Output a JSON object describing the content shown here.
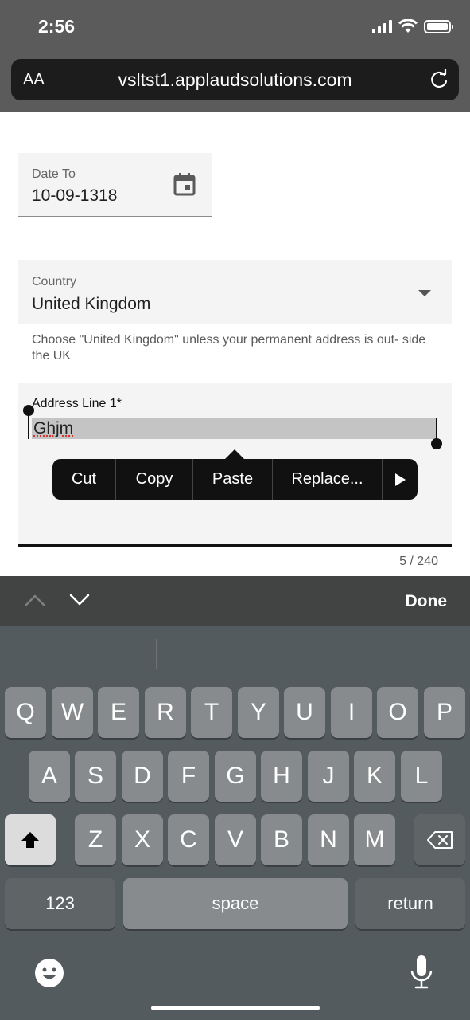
{
  "status_bar": {
    "time": "2:56"
  },
  "browser": {
    "aa_label": "AA",
    "url": "vsltst1.applaudsolutions.com"
  },
  "form": {
    "date_to": {
      "label": "Date To",
      "value": "10-09-1318"
    },
    "country": {
      "label": "Country",
      "value": "United Kingdom",
      "helper": "Choose \"United Kingdom\" unless your permanent address is out- side the UK"
    },
    "address_line_1": {
      "label": "Address Line 1*",
      "value": "Ghjm",
      "counter": "5 / 240"
    }
  },
  "context_menu": {
    "cut": "Cut",
    "copy": "Copy",
    "paste": "Paste",
    "replace": "Replace..."
  },
  "accessory_bar": {
    "done": "Done"
  },
  "keyboard": {
    "row1": [
      "Q",
      "W",
      "E",
      "R",
      "T",
      "Y",
      "U",
      "I",
      "O",
      "P"
    ],
    "row2": [
      "A",
      "S",
      "D",
      "F",
      "G",
      "H",
      "J",
      "K",
      "L"
    ],
    "row3": [
      "Z",
      "X",
      "C",
      "V",
      "B",
      "N",
      "M"
    ],
    "numbers_key": "123",
    "space_key": "space",
    "return_key": "return"
  }
}
